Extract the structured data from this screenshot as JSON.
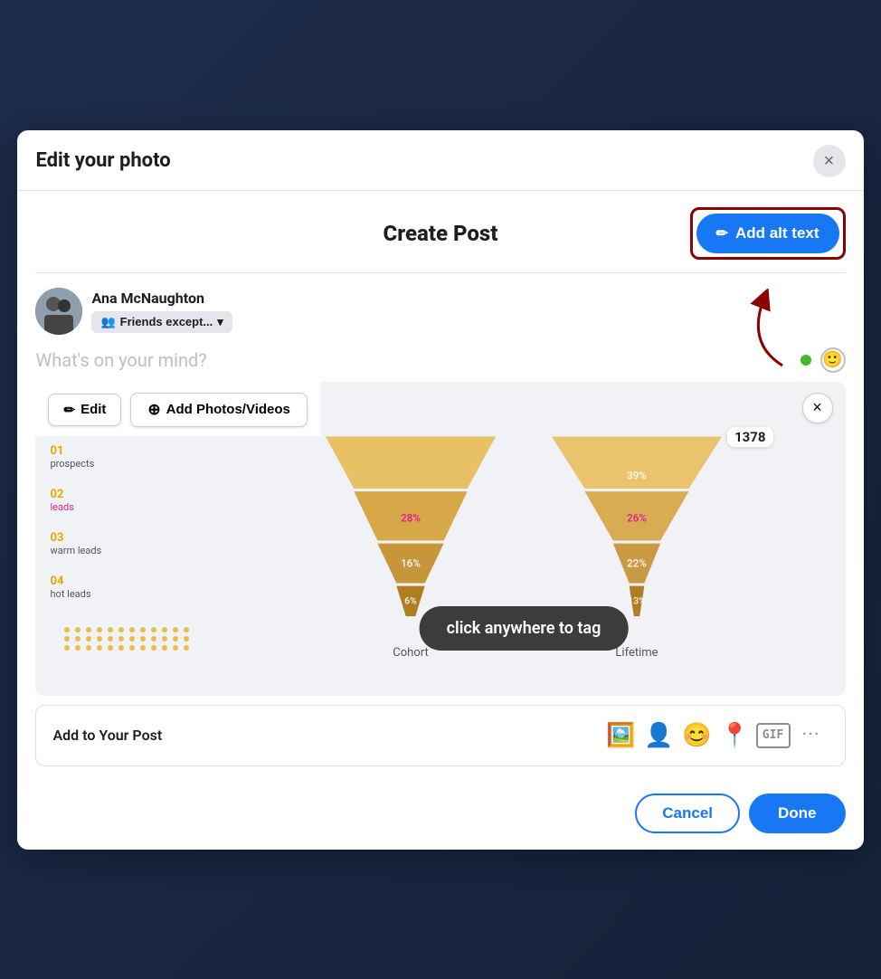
{
  "modal": {
    "title": "Edit your photo",
    "close_label": "×"
  },
  "create_post": {
    "title": "Create Post",
    "add_alt_text_label": "Add alt text",
    "pencil_icon": "✏"
  },
  "user": {
    "name": "Ana McNaughton",
    "audience": "Friends except...",
    "audience_icon": "👥",
    "placeholder": "What's on your mind?"
  },
  "image_toolbar": {
    "edit_label": "Edit",
    "edit_icon": "✏",
    "add_photos_label": "Add Photos/Videos",
    "add_photos_icon": "⊕",
    "close_icon": "×"
  },
  "funnel_chart": {
    "count_badge": "1378",
    "labels": [
      {
        "num": "01",
        "text": "prospects",
        "color": "normal"
      },
      {
        "num": "02",
        "text": "leads",
        "color": "pink"
      },
      {
        "num": "03",
        "text": "warm leads",
        "color": "normal"
      },
      {
        "num": "04",
        "text": "hot leads",
        "color": "normal"
      }
    ],
    "charts": [
      {
        "label": "Cohort"
      },
      {
        "label": "Lifetime"
      }
    ],
    "tag_tooltip": "click anywhere to tag"
  },
  "add_to_post": {
    "label": "Add to Your Post",
    "icons": [
      {
        "name": "photo-video-icon",
        "symbol": "🖼"
      },
      {
        "name": "tag-people-icon",
        "symbol": "👤"
      },
      {
        "name": "emoji-feeling-icon",
        "symbol": "😊"
      },
      {
        "name": "check-in-icon",
        "symbol": "📍"
      },
      {
        "name": "gif-icon",
        "symbol": "GIF"
      },
      {
        "name": "more-icon",
        "symbol": "···"
      }
    ]
  },
  "footer": {
    "cancel_label": "Cancel",
    "done_label": "Done"
  }
}
